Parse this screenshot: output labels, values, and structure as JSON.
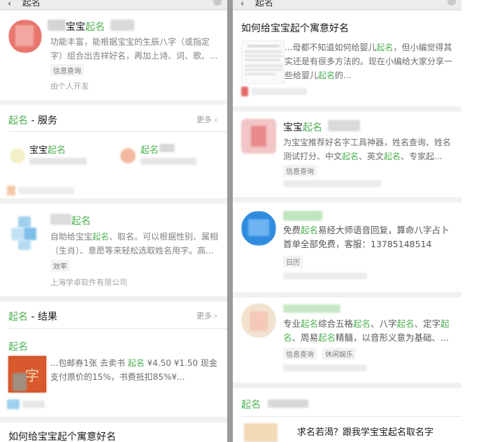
{
  "left": {
    "topbar": {
      "title": "起名"
    },
    "app_card": {
      "name_mid": "宝宝",
      "name_kw": "起名",
      "desc": "功能丰富，能根据宝宝的生辰八字（或指定字）组合出吉祥好名，再加上诗、词、歌、...",
      "tag": "信息查询",
      "developer": "由个人开发"
    },
    "service_section": {
      "title_kw": "起名",
      "title_rest": " - 服务",
      "more": "更多",
      "item1_prefix": "宝宝",
      "item1_kw": "起名",
      "item2_kw": "起名"
    },
    "app_card2": {
      "name_kw": "起名",
      "desc_1": "自助给宝宝",
      "desc_kw": "起名",
      "desc_2": "、取名。可以根据性别、属相（生肖）、意愿等来轻松选取姓名用字。高...",
      "tag": "效率",
      "developer": "上海学卓软件有限公司"
    },
    "result_section": {
      "title_kw": "起名",
      "title_rest": " - 结果",
      "more": "更多",
      "sub_kw": "起名",
      "text_1": "...包邮券1张 去卖书 ",
      "text_kw": "起名",
      "text_2": " ¥4.50 ¥1.50 现金支付原价的15%，书费抵扣85%¥..."
    },
    "bottom_title": "如何给宝宝起个寓意好名"
  },
  "right": {
    "topbar": {
      "title": "起名"
    },
    "article": {
      "title": "如何给宝宝起个寓意好名",
      "text_1": "...母都不知道如何给婴儿",
      "text_kw1": "起名",
      "text_2": "，但小编觉得其实还是有很多方法的。现在小编给大家分享一些给婴儿",
      "text_kw2": "起名",
      "text_3": "的..."
    },
    "app1": {
      "name_prefix": "宝宝",
      "name_kw": "起名",
      "desc_1": "为宝宝推荐好名字工具神器，姓名查询、姓名测试打分、中文",
      "desc_kw1": "起名",
      "desc_2": "、英文",
      "desc_kw2": "起名",
      "desc_3": "、专家起...",
      "tag": "信息查询"
    },
    "app2": {
      "desc_1": "免费",
      "desc_kw": "起名",
      "desc_2": "易经大师语音回复，算命八字占卜首单全部免费，客服：13785148514",
      "tag": "日历"
    },
    "app3": {
      "desc_1": "专业",
      "desc_kw1": "起名",
      "desc_2": "综合五格",
      "desc_kw2": "起名",
      "desc_3": "、八字",
      "desc_kw3": "起名",
      "desc_4": "、定字",
      "desc_kw4": "起名",
      "desc_5": "、周易",
      "desc_kw5": "起名",
      "desc_6": "精髓，以音形义意为基础、...",
      "tag1": "信息查询",
      "tag2": "休闲娱乐"
    },
    "section": {
      "title_kw": "起名"
    },
    "bottom_title": "求名若渴？跟我学宝宝起名取名字"
  },
  "colors": {
    "keyword": "#4caf50",
    "gray_text": "#808080",
    "divider": "#9a9a9a"
  }
}
